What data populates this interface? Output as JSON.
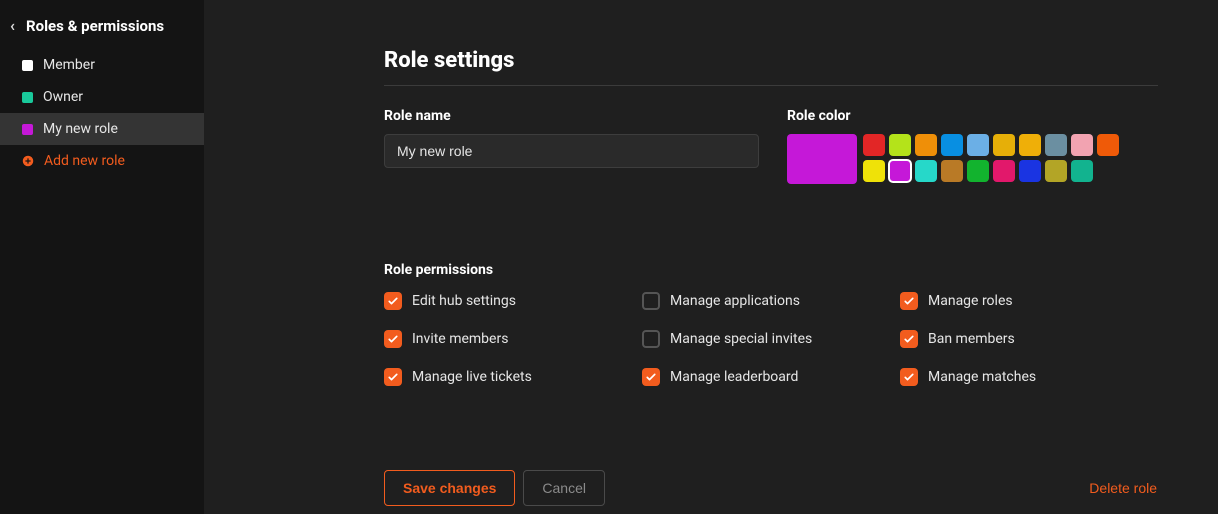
{
  "sidebar": {
    "title": "Roles & permissions",
    "roles": [
      {
        "label": "Member",
        "color": "#ffffff"
      },
      {
        "label": "Owner",
        "color": "#19c99b"
      },
      {
        "label": "My new role",
        "color": "#c518d8"
      }
    ],
    "selected_index": 2,
    "add_role_label": "Add new role"
  },
  "main": {
    "page_title": "Role settings",
    "role_name_label": "Role name",
    "role_name_value": "My new role",
    "role_color_label": "Role color",
    "current_color": "#c518d8",
    "color_options": [
      "#e22626",
      "#b4e31a",
      "#ef8f08",
      "#088fe2",
      "#6bafe6",
      "#e6af08",
      "#efaf08",
      "#6b8fa1",
      "#f2a3b1",
      "#ef5a08",
      "#efe208",
      "#c518d8",
      "#26d8c9",
      "#b97a26",
      "#12b32e",
      "#e2186b",
      "#1a34e2",
      "#b3a526",
      "#12b38f",
      ""
    ],
    "selected_color_index": 11,
    "permissions_label": "Role permissions",
    "permissions": [
      {
        "label": "Edit hub settings",
        "checked": true
      },
      {
        "label": "Manage applications",
        "checked": false
      },
      {
        "label": "Manage roles",
        "checked": true
      },
      {
        "label": "Invite members",
        "checked": true
      },
      {
        "label": "Manage special invites",
        "checked": false
      },
      {
        "label": "Ban members",
        "checked": true
      },
      {
        "label": "Manage live tickets",
        "checked": true
      },
      {
        "label": "Manage leaderboard",
        "checked": true
      },
      {
        "label": "Manage matches",
        "checked": true
      }
    ],
    "save_label": "Save changes",
    "cancel_label": "Cancel",
    "delete_label": "Delete role"
  }
}
